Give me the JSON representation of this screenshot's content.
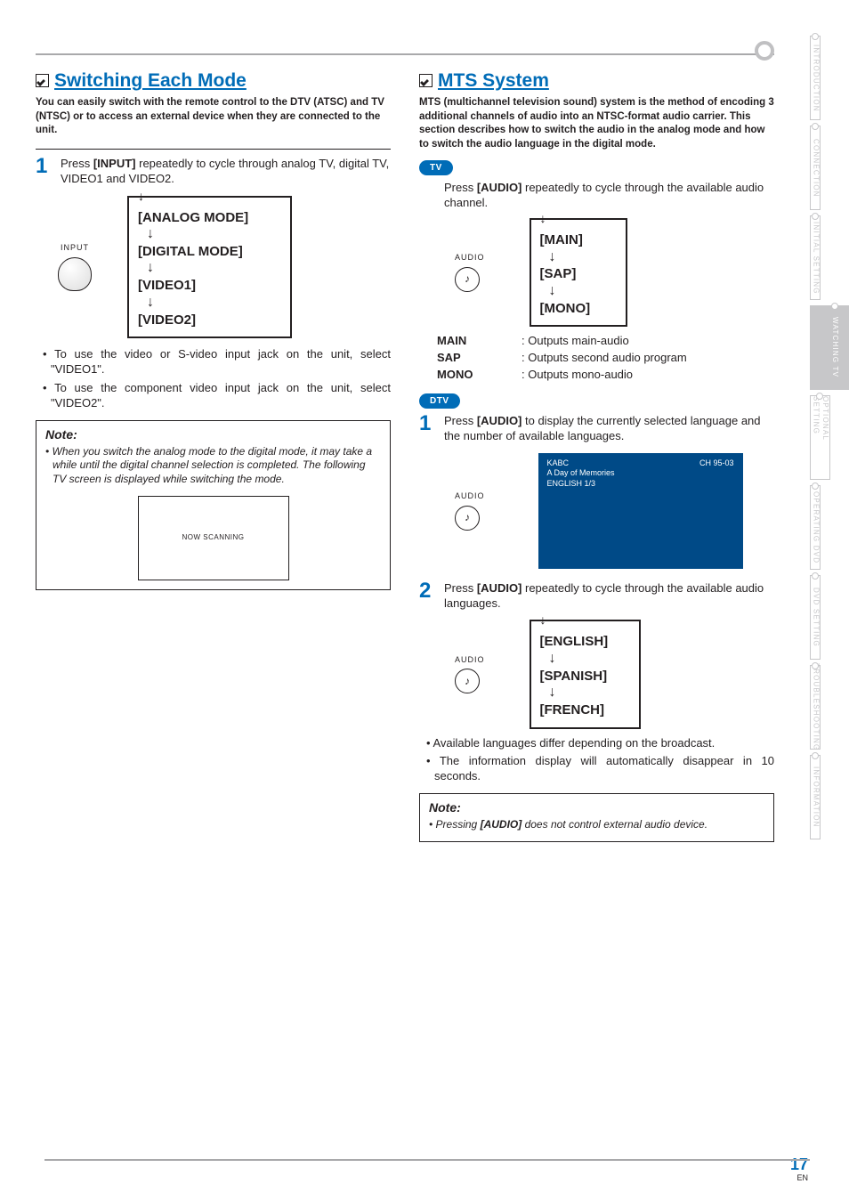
{
  "page": {
    "number": "17",
    "lang": "EN"
  },
  "tabs": [
    "INTRODUCTION",
    "CONNECTION",
    "INITIAL SETTING",
    "WATCHING TV",
    "OPTIONAL SETTING",
    "OPERATING DVD",
    "DVD SETTING",
    "TROUBLESHOOTING",
    "INFORMATION"
  ],
  "active_tab_index": 3,
  "left": {
    "heading": "Switching Each Mode",
    "intro": "You can easily switch with the remote control to the DTV (ATSC) and TV (NTSC) or to access an external device when they are connected to the unit.",
    "step1_a": "Press ",
    "step1_key": "[INPUT]",
    "step1_b": " repeatedly to cycle through analog TV, digital TV, VIDEO1 and VIDEO2.",
    "input_label": "INPUT",
    "cycle": [
      "[ANALOG MODE]",
      "[DIGITAL MODE]",
      "[VIDEO1]",
      "[VIDEO2]"
    ],
    "bullets": [
      "To use the video or S-video input jack on the unit, select \"VIDEO1\".",
      "To use the component video input jack on the unit, select \"VIDEO2\"."
    ],
    "note_title": "Note:",
    "note_text": "When you switch the analog mode to the digital mode, it may take a while until the digital channel selection is completed. The following TV screen is displayed while switching the mode.",
    "scan_text": "NOW SCANNING"
  },
  "right": {
    "heading": "MTS System",
    "intro": "MTS (multichannel television sound) system is the method of encoding 3 additional channels of audio into an NTSC-format audio carrier. This section describes how to switch the audio in the analog mode and how to switch the audio language in the digital mode.",
    "pill_tv": "TV",
    "tv_step_a": "Press ",
    "tv_step_key": "[AUDIO]",
    "tv_step_b": " repeatedly to cycle through the available audio channel.",
    "audio_label": "AUDIO",
    "tv_cycle": [
      "[MAIN]",
      "[SAP]",
      "[MONO]"
    ],
    "defs": [
      {
        "k": "MAIN",
        "v": "Outputs main-audio"
      },
      {
        "k": "SAP",
        "v": "Outputs second audio program"
      },
      {
        "k": "MONO",
        "v": "Outputs mono-audio"
      }
    ],
    "pill_dtv": "DTV",
    "d1_a": "Press ",
    "d1_key": "[AUDIO]",
    "d1_b": " to display the currently selected language and the number of available languages.",
    "osd": {
      "line1": "KABC",
      "line2": "A Day of Memories",
      "line3": "ENGLISH 1/3",
      "right": "CH 95-03"
    },
    "d2_a": "Press ",
    "d2_key": "[AUDIO]",
    "d2_b": " repeatedly to cycle through the available audio languages.",
    "lang_cycle": [
      "[ENGLISH]",
      "[SPANISH]",
      "[FRENCH]"
    ],
    "lang_bullets": [
      "Available languages differ depending on the broadcast.",
      "The information display will automatically disappear in 10 seconds."
    ],
    "note_title": "Note:",
    "note_text_a": "Pressing ",
    "note_text_key": "[AUDIO]",
    "note_text_b": " does not control external audio device."
  }
}
